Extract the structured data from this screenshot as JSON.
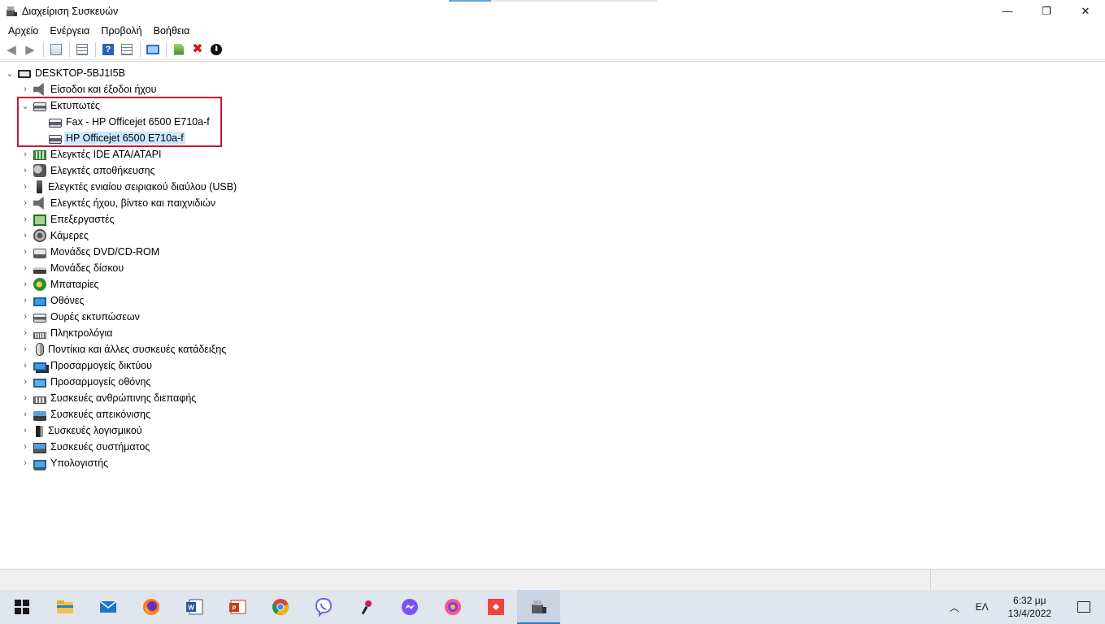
{
  "window": {
    "title": "Διαχείριση Συσκευών",
    "minimize": "—",
    "maximize": "❐",
    "close": "✕"
  },
  "menu": [
    "Αρχείο",
    "Ενέργεια",
    "Προβολή",
    "Βοήθεια"
  ],
  "toolbar": {
    "help_label": "?",
    "remove_label": "✖",
    "update_label": "⬇"
  },
  "tree": {
    "root": "DESKTOP-5BJ1I5B",
    "items": [
      {
        "label": "Είσοδοι και έξοδοι ήχου",
        "icon": "speaker-icon",
        "expanded": false
      },
      {
        "label": "Εκτυπωτές",
        "icon": "printer-icon",
        "expanded": true,
        "children": [
          {
            "label": "Fax - HP Officejet 6500 E710a-f",
            "icon": "printer-icon",
            "selected": false
          },
          {
            "label": "HP Officejet 6500 E710a-f",
            "icon": "printer-icon",
            "selected": true
          }
        ]
      },
      {
        "label": "Ελεγκτές IDE ATA/ATAPI",
        "icon": "ide-controller-icon",
        "expanded": false
      },
      {
        "label": "Ελεγκτές αποθήκευσης",
        "icon": "storage-controller-icon",
        "expanded": false
      },
      {
        "label": "Ελεγκτές ενιαίου σειριακού διαύλου (USB)",
        "icon": "usb-icon",
        "expanded": false
      },
      {
        "label": "Ελεγκτές ήχου, βίντεο και παιχνιδιών",
        "icon": "speaker-icon",
        "expanded": false
      },
      {
        "label": "Επεξεργαστές",
        "icon": "cpu-icon",
        "expanded": false
      },
      {
        "label": "Κάμερες",
        "icon": "camera-icon",
        "expanded": false
      },
      {
        "label": "Μονάδες DVD/CD-ROM",
        "icon": "dvd-icon",
        "expanded": false
      },
      {
        "label": "Μονάδες δίσκου",
        "icon": "disk-icon",
        "expanded": false
      },
      {
        "label": "Μπαταρίες",
        "icon": "battery-icon",
        "expanded": false
      },
      {
        "label": "Οθόνες",
        "icon": "monitor-icon",
        "expanded": false
      },
      {
        "label": "Ουρές εκτυπώσεων",
        "icon": "print-queue-icon",
        "expanded": false
      },
      {
        "label": "Πληκτρολόγια",
        "icon": "keyboard-icon",
        "expanded": false
      },
      {
        "label": "Ποντίκια και άλλες συσκευές κατάδειξης",
        "icon": "mouse-icon",
        "expanded": false
      },
      {
        "label": "Προσαρμογείς δικτύου",
        "icon": "network-adapter-icon",
        "expanded": false
      },
      {
        "label": "Προσαρμογείς οθόνης",
        "icon": "display-adapter-icon",
        "expanded": false
      },
      {
        "label": "Συσκευές ανθρώπινης διεπαφής",
        "icon": "hid-icon",
        "expanded": false
      },
      {
        "label": "Συσκευές απεικόνισης",
        "icon": "imaging-device-icon",
        "expanded": false
      },
      {
        "label": "Συσκευές λογισμικού",
        "icon": "software-device-icon",
        "expanded": false
      },
      {
        "label": "Συσκευές συστήματος",
        "icon": "system-device-icon",
        "expanded": false
      },
      {
        "label": "Υπολογιστής",
        "icon": "computer-icon",
        "expanded": false
      }
    ]
  },
  "taskbar": {
    "apps": [
      "start-icon",
      "file-explorer-icon",
      "mail-icon",
      "firefox-icon",
      "word-icon",
      "powerpoint-icon",
      "chrome-icon",
      "viber-icon",
      "app-icon",
      "messenger-icon",
      "browser-icon",
      "anydesk-icon",
      "device-manager-icon"
    ],
    "language": "ΕΛ",
    "time": "6:32 μμ",
    "date": "13/4/2022"
  },
  "colors": {
    "highlight_border": "#c8182b",
    "selection": "#cce8ff",
    "taskbar": "#dfe6ee"
  }
}
